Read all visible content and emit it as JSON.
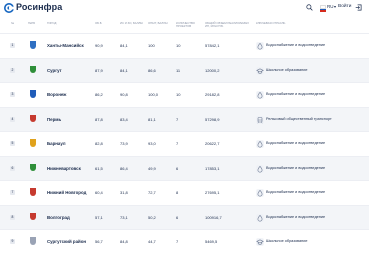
{
  "brand": {
    "name": "Росинфра"
  },
  "header": {
    "language": "RU",
    "login_label": "Войти"
  },
  "colors": {
    "brand": "#1565c0",
    "accent": "#1a2b4c",
    "row_alt": "#f3f5f8"
  },
  "table": {
    "columns": [
      "№",
      "Герб",
      "Город",
      "Об.б",
      "ИС и ЗО, баллы",
      "Опыт, баллы",
      "Количество проектов",
      "Общий объем реализуемых ИП, млн руб.",
      "Ключевая отрасль"
    ],
    "rows": [
      {
        "rank": "1",
        "coat_color": "#2e6fc2",
        "city": "Ханты-Мансийск",
        "obb": "90,9",
        "iszo": "84,1",
        "exp": "100",
        "projects": "10",
        "volume": "57842,1",
        "sector": "Водоснабжение и водоотведение",
        "sector_icon": "water-drop-icon"
      },
      {
        "rank": "2",
        "coat_color": "#2f8f3a",
        "city": "Сургут",
        "obb": "87,9",
        "iszo": "84,1",
        "exp": "86,6",
        "projects": "11",
        "volume": "12000,2",
        "sector": "Школьное образование",
        "sector_icon": "school-icon"
      },
      {
        "rank": "3",
        "coat_color": "#1f5cb8",
        "city": "Воронеж",
        "obb": "86,2",
        "iszo": "90,8",
        "exp": "100,0",
        "projects": "10",
        "volume": "29182,8",
        "sector": "Водоснабжение и водоотведение",
        "sector_icon": "water-drop-icon"
      },
      {
        "rank": "4",
        "coat_color": "#c63a2f",
        "city": "Пермь",
        "obb": "87,8",
        "iszo": "83,4",
        "exp": "81,1",
        "projects": "7",
        "volume": "57298,9",
        "sector": "Рельсовый общественный транспорт",
        "sector_icon": "tram-icon"
      },
      {
        "rank": "5",
        "coat_color": "#e0a21c",
        "city": "Барнаул",
        "obb": "82,8",
        "iszo": "73,9",
        "exp": "93,0",
        "projects": "7",
        "volume": "20622,7",
        "sector": "Водоснабжение и водоотведение",
        "sector_icon": "water-drop-icon"
      },
      {
        "rank": "6",
        "coat_color": "#2f8f3a",
        "city": "Нижневартовск",
        "obb": "61,5",
        "iszo": "86,4",
        "exp": "49,9",
        "projects": "6",
        "volume": "17853,1",
        "sector": "Водоснабжение и водоотведение",
        "sector_icon": "water-drop-icon"
      },
      {
        "rank": "7",
        "coat_color": "#c63a2f",
        "city": "Нижний Новгород",
        "obb": "60,4",
        "iszo": "31,8",
        "exp": "72,7",
        "projects": "8",
        "volume": "27695,1",
        "sector": "Водоснабжение и водоотведение",
        "sector_icon": "water-drop-icon"
      },
      {
        "rank": "8",
        "coat_color": "#c63a2f",
        "city": "Волгоград",
        "obb": "57,1",
        "iszo": "73,1",
        "exp": "50,2",
        "projects": "6",
        "volume": "100916,7",
        "sector": "Водоснабжение и водоотведение",
        "sector_icon": "water-drop-icon"
      },
      {
        "rank": "9",
        "coat_color": "#9aa3b5",
        "city": "Сургутский район",
        "obb": "56,7",
        "iszo": "84,8",
        "exp": "44,7",
        "projects": "7",
        "volume": "5469,5",
        "sector": "Школьное образование",
        "sector_icon": "school-icon"
      }
    ]
  }
}
